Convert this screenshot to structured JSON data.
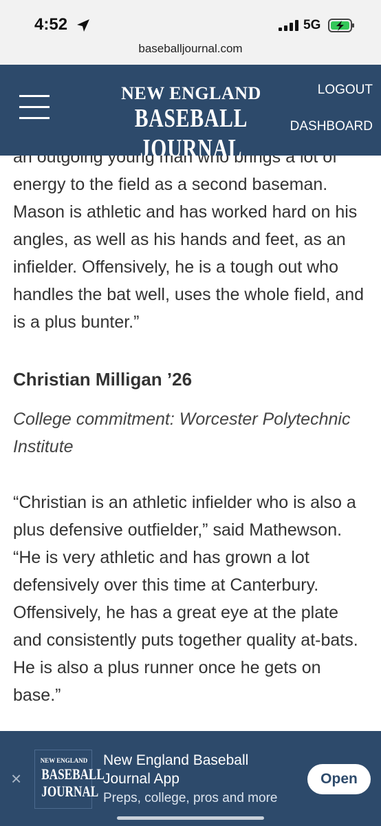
{
  "status_bar": {
    "time": "4:52",
    "network": "5G"
  },
  "browser": {
    "url": "baseballjournal.com"
  },
  "site_header": {
    "logo_line1": "NEW ENGLAND",
    "logo_line2": "BASEBALL JOURNAL",
    "logout_label": "LOGOUT",
    "dashboard_label": "DASHBOARD",
    "background_color": "#2d4a6b"
  },
  "article": {
    "partial_line": "an outgoing young man who brings a lot of",
    "paragraph1": "energy to the field as a second baseman. Mason is athletic and has worked hard on his angles, as well as his hands and feet, as an infielder. Offensively, he is a tough out who handles the bat well, uses the whole field, and is a plus bunter.”",
    "player_heading": "Christian Milligan ’26",
    "commitment": "College commitment: Worcester Polytechnic Institute",
    "paragraph2": "“Christian is an athletic infielder who is also a plus defensive outfielder,” said Mathewson. “He is very athletic and has grown a lot defensively over this time at Canterbury. Offensively, he has a great eye at the plate and consistently puts together quality at-bats. He is also a plus runner once he gets on base.”"
  },
  "app_banner": {
    "logo_line1": "NEW ENGLAND",
    "logo_line2": "BASEBALL",
    "logo_line3": "JOURNAL",
    "title": "New England Baseball Journal App",
    "subtitle": "Preps, college, pros and more",
    "open_label": "Open",
    "close_symbol": "×"
  }
}
